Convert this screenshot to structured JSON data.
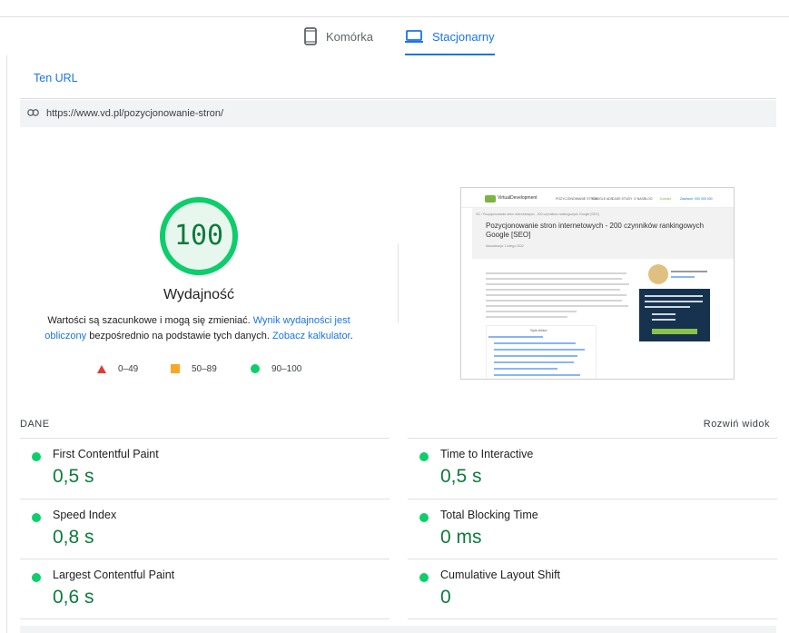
{
  "device_tabs": [
    {
      "label": "Komórka",
      "icon": "smartphone-icon",
      "active": false
    },
    {
      "label": "Stacjonarny",
      "icon": "laptop-icon",
      "active": true
    }
  ],
  "url_tab": {
    "label": "Ten URL"
  },
  "url_bar": {
    "icon": "link-icon",
    "url": "https://www.vd.pl/pozycjonowanie-stron/"
  },
  "score": {
    "value": "100",
    "fraction": 1.0,
    "title": "Wydajność",
    "desc_before": "Wartości są szacunkowe i mogą się zmieniać. ",
    "desc_link1": "Wynik wydajności jest obliczony",
    "desc_middle": " bezpośrednio na podstawie tych danych. ",
    "desc_link2": "Zobacz kalkulator",
    "desc_after": "."
  },
  "legend": [
    {
      "shape": "triangle",
      "range": "0–49",
      "color": "#e53935"
    },
    {
      "shape": "square",
      "range": "50–89",
      "color": "#f9a825"
    },
    {
      "shape": "circle",
      "range": "90–100",
      "color": "#0cce6b"
    }
  ],
  "thumbnail": {
    "logo": "VirtualDevelopment",
    "nav": [
      "POZYCJONOWANIE STRON",
      "GOOGLE ADS",
      "CASE STUDY",
      "O NAS",
      "BLOG",
      "Kontakt",
      "Zadzwoń: 000 000 000"
    ],
    "breadcrumb": "VD › Pozycjonowanie stron internetowych - 200 czynników rankingowych Google [SEO]",
    "headline": "Pozycjonowanie stron internetowych - 200 czynników rankingowych Google [SEO]",
    "meta": "Aktualizacja: 1 lutego 2022",
    "toc_title": "Spis treści"
  },
  "data_section": {
    "label": "DANE",
    "expand_label": "Rozwiń widok"
  },
  "metrics": [
    {
      "name": "First Contentful Paint",
      "value": "0,5 s"
    },
    {
      "name": "Time to Interactive",
      "value": "0,5 s"
    },
    {
      "name": "Speed Index",
      "value": "0,8 s"
    },
    {
      "name": "Total Blocking Time",
      "value": "0 ms"
    },
    {
      "name": "Largest Contentful Paint",
      "value": "0,6 s"
    },
    {
      "name": "Cumulative Layout Shift",
      "value": "0"
    }
  ],
  "colors": {
    "accent": "#1a73e8",
    "good": "#0cce6b",
    "good_text": "#0d7a3e"
  }
}
